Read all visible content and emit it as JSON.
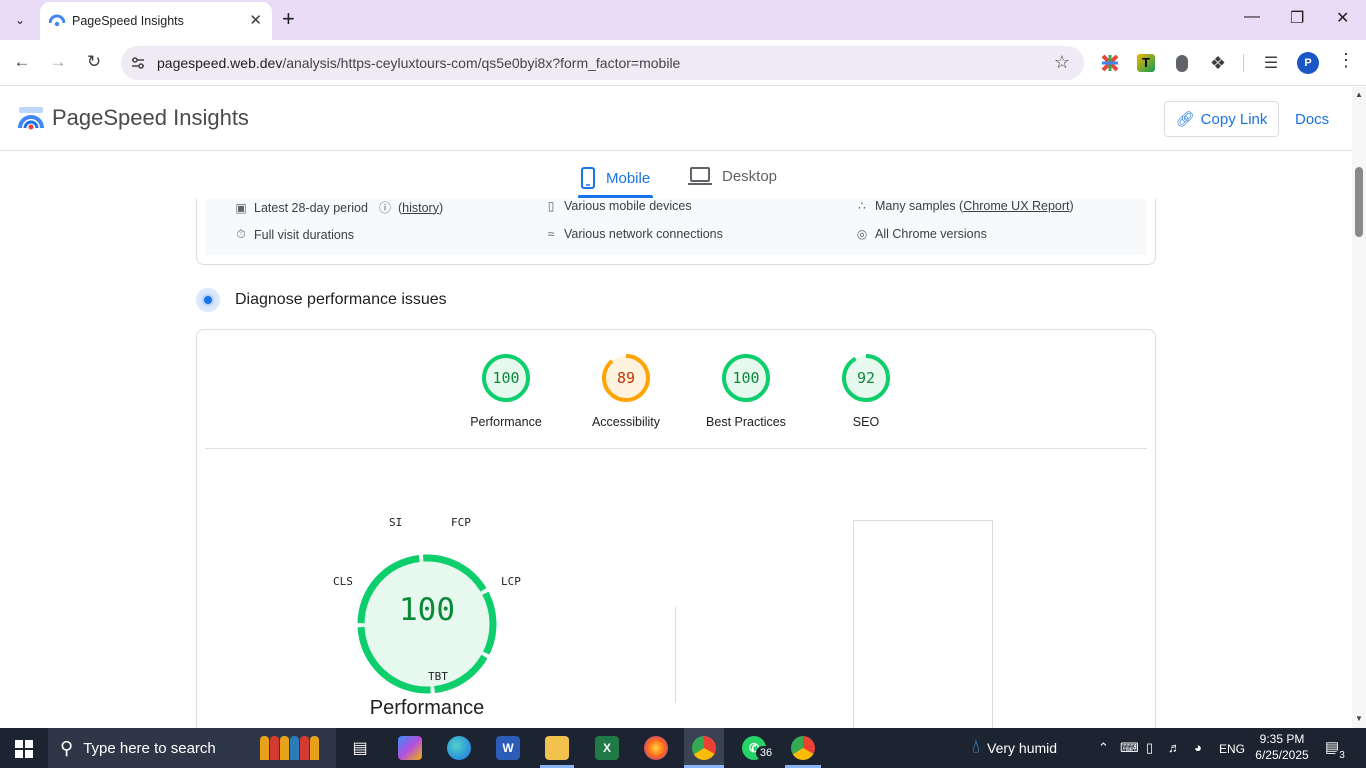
{
  "browser": {
    "tab_title": "PageSpeed Insights",
    "url_host": "pagespeed.web.dev",
    "url_path": "/analysis/https-ceyluxtours-com/qs5e0byi8x?form_factor=mobile",
    "profile_initial": "P"
  },
  "header": {
    "title": "PageSpeed Insights",
    "copy_link_label": "Copy Link",
    "docs_label": "Docs"
  },
  "device_tabs": {
    "mobile": "Mobile",
    "desktop": "Desktop",
    "selected": "Mobile"
  },
  "field_data": {
    "period_label": "Latest 28-day period",
    "history_link": "history",
    "devices": "Various mobile devices",
    "samples_prefix": "Many samples (",
    "samples_link": "Chrome UX Report",
    "samples_suffix": ")",
    "durations": "Full visit durations",
    "network": "Various network connections",
    "chrome_versions": "All Chrome versions"
  },
  "diagnose": {
    "title": "Diagnose performance issues"
  },
  "scores": [
    {
      "label": "Performance",
      "value": "100",
      "status": "pass"
    },
    {
      "label": "Accessibility",
      "value": "89",
      "status": "average"
    },
    {
      "label": "Best Practices",
      "value": "100",
      "status": "pass"
    },
    {
      "label": "SEO",
      "value": "92",
      "status": "pass"
    }
  ],
  "performance_gauge": {
    "score": "100",
    "title": "Performance",
    "metrics": {
      "si": "SI",
      "fcp": "FCP",
      "lcp": "LCP",
      "tbt": "TBT",
      "cls": "CLS"
    }
  },
  "colors": {
    "pass": "#0cce6b",
    "pass_text": "#0b8a3a",
    "pass_bg": "#e7f8ee",
    "average": "#ffa400",
    "average_text": "#c33300",
    "average_bg": "#fff3e0",
    "accent": "#1a73e8"
  },
  "taskbar": {
    "search_placeholder": "Type here to search",
    "whatsapp_badge": "36",
    "weather": "Very humid",
    "language": "ENG",
    "time": "9:35 PM",
    "date": "6/25/2025",
    "notifications": "3"
  }
}
